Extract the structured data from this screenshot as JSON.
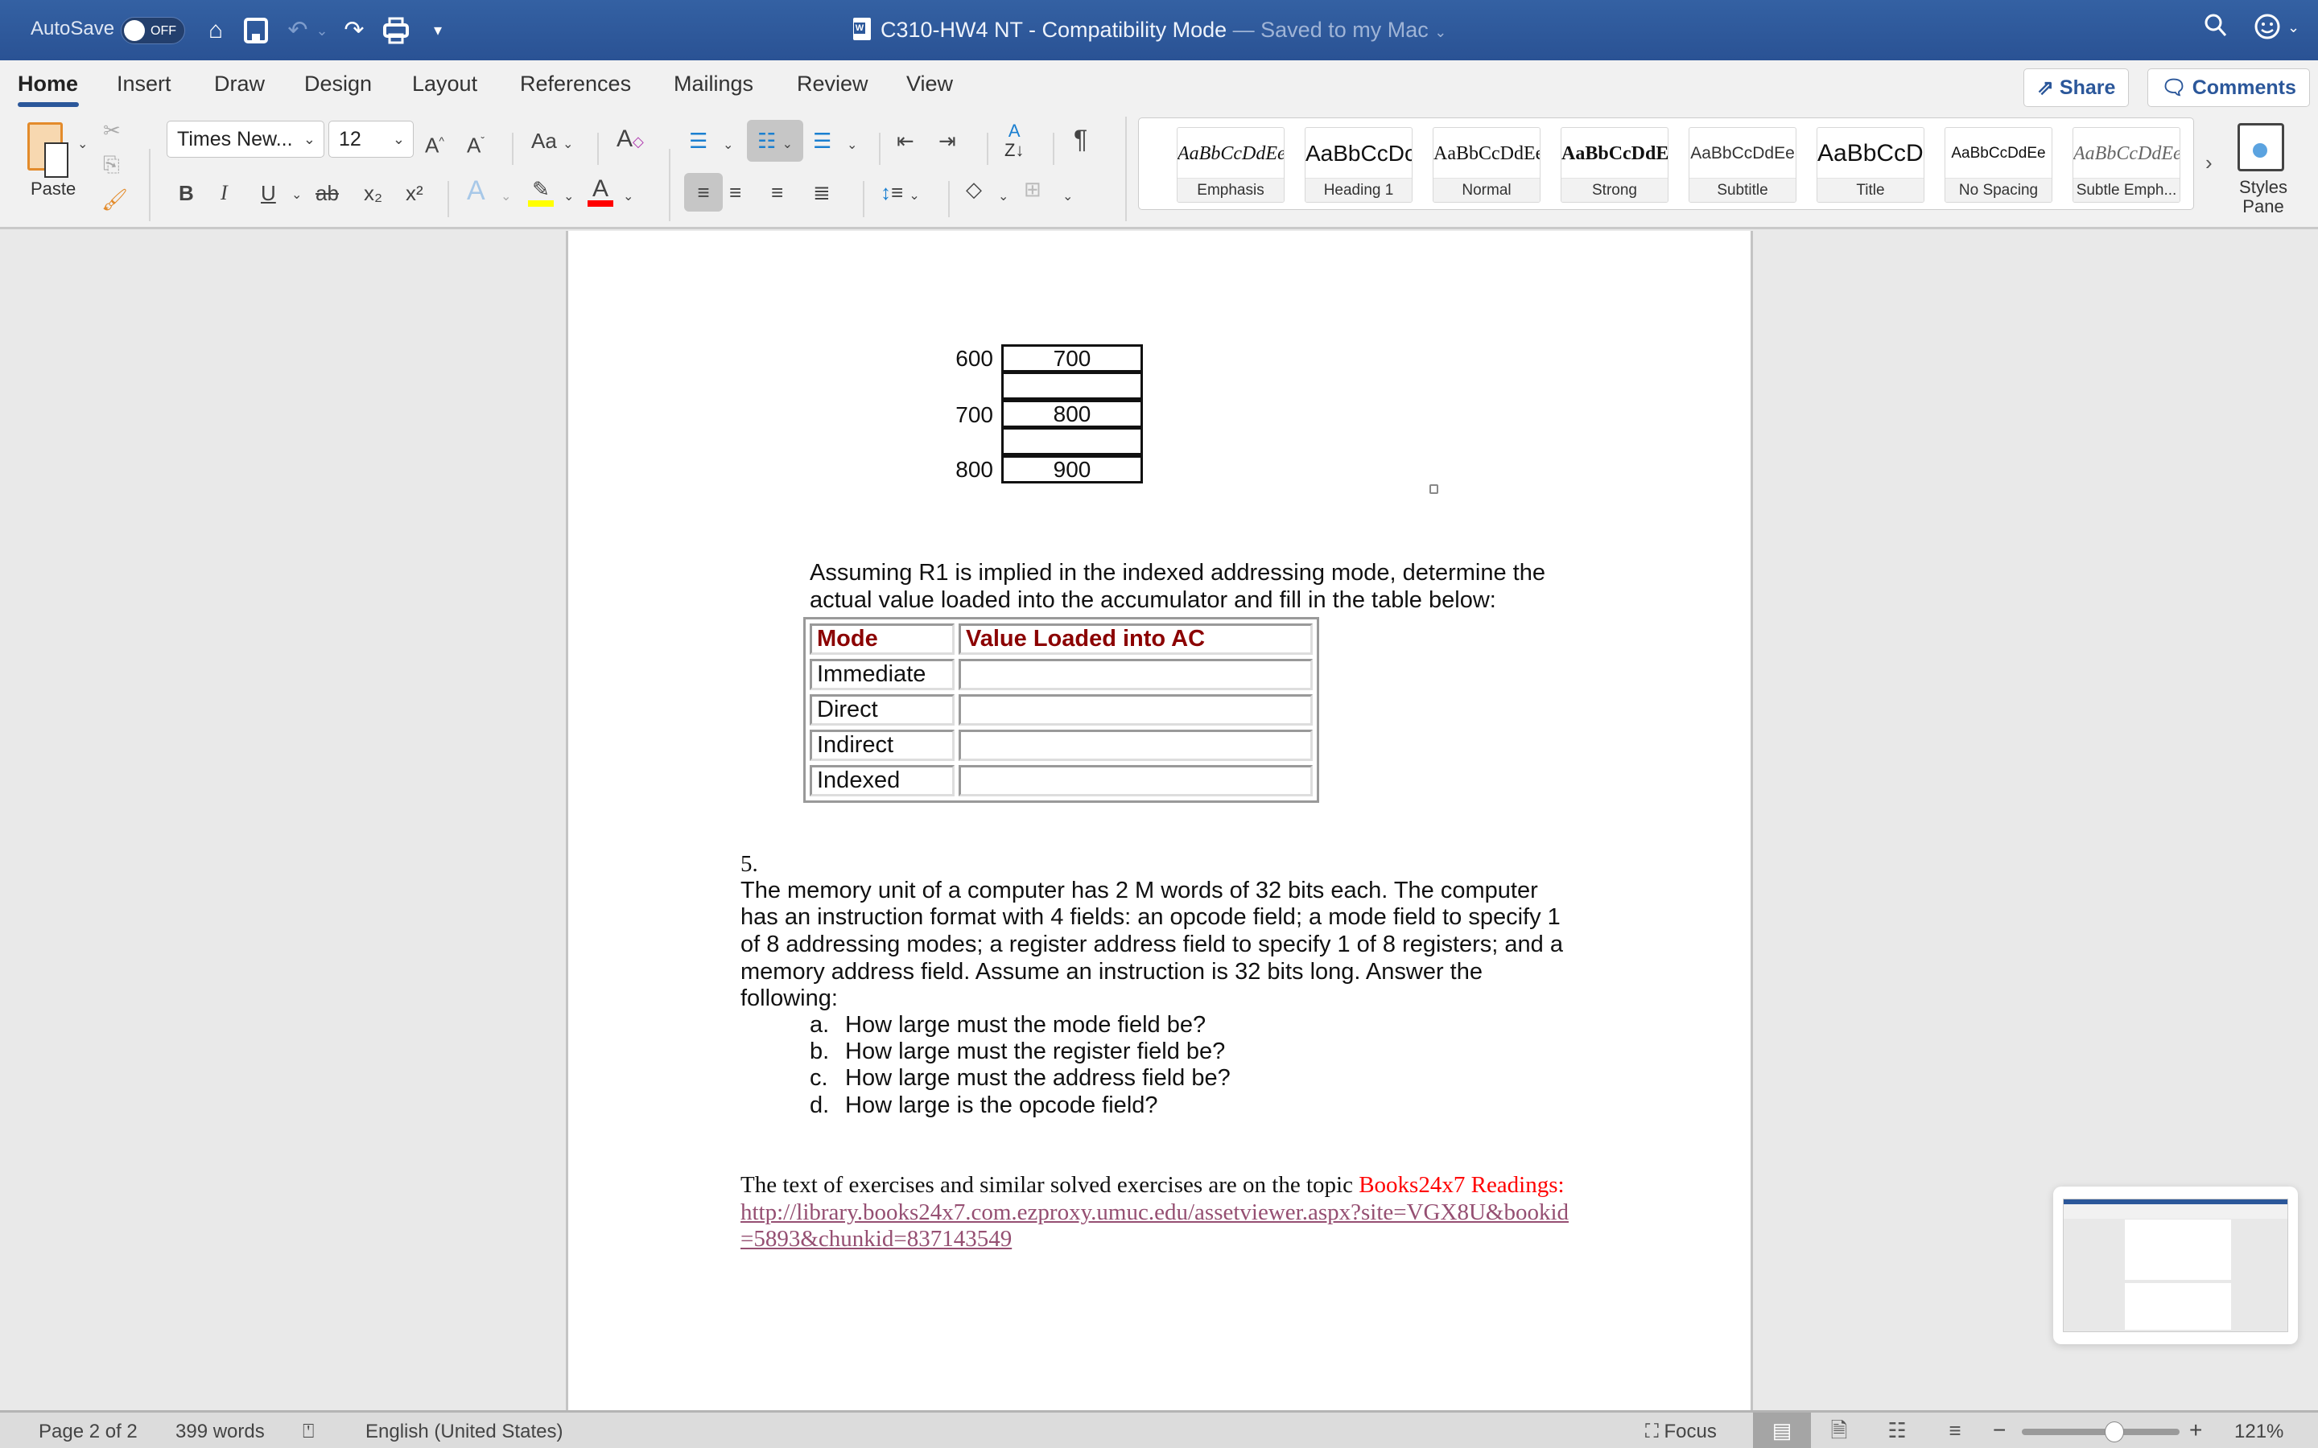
{
  "titlebar": {
    "autosave_label": "AutoSave",
    "autosave_state": "OFF",
    "doc_title": "C310-HW4 NT  -  Compatibility Mode",
    "saved_status": "— Saved to my Mac",
    "icons": [
      "home-icon",
      "save-icon",
      "undo-icon",
      "redo-icon",
      "print-icon",
      "customize-qat-icon",
      "search-icon",
      "feedback-smiley-icon"
    ]
  },
  "tabs": [
    {
      "label": "Home",
      "active": true
    },
    {
      "label": "Insert"
    },
    {
      "label": "Draw"
    },
    {
      "label": "Design"
    },
    {
      "label": "Layout"
    },
    {
      "label": "References"
    },
    {
      "label": "Mailings"
    },
    {
      "label": "Review"
    },
    {
      "label": "View"
    }
  ],
  "top_buttons": {
    "share": "Share",
    "comments": "Comments"
  },
  "ribbon": {
    "paste_label": "Paste",
    "font_name": "Times New...",
    "font_size": "12",
    "change_case": "Aa",
    "bold": "B",
    "italic": "I",
    "underline": "U",
    "strikethrough": "ab",
    "subscript": "x₂",
    "superscript": "x²",
    "highlight_color": "#ffff00",
    "font_color": "#ff0000",
    "styles": [
      {
        "sample": "AaBbCcDdEe",
        "name": "Emphasis"
      },
      {
        "sample": "AaBbCcDc",
        "name": "Heading 1"
      },
      {
        "sample": "AaBbCcDdEe",
        "name": "Normal"
      },
      {
        "sample": "AaBbCcDdE",
        "name": "Strong"
      },
      {
        "sample": "AaBbCcDdEe",
        "name": "Subtitle"
      },
      {
        "sample": "AaBbCcDc",
        "name": "Title"
      },
      {
        "sample": "AaBbCcDdEe",
        "name": "No Spacing"
      },
      {
        "sample": "AaBbCcDdEe",
        "name": "Subtle Emph..."
      }
    ],
    "styles_pane_label": "Styles Pane"
  },
  "document": {
    "memory_rows": [
      {
        "address": "600",
        "content": "700"
      },
      {
        "address": "",
        "content": ""
      },
      {
        "address": "700",
        "content": "800"
      },
      {
        "address": "",
        "content": ""
      },
      {
        "address": "800",
        "content": "900"
      }
    ],
    "instructions_line1": "Assuming R1 is implied in the indexed addressing mode, determine the",
    "instructions_line2": "actual value loaded into the accumulator and fill in the table below:",
    "ac_table": {
      "headers": [
        "Mode",
        "Value Loaded into AC"
      ],
      "rows": [
        [
          "Immediate",
          ""
        ],
        [
          "Direct",
          ""
        ],
        [
          "Indirect",
          ""
        ],
        [
          "Indexed",
          ""
        ]
      ]
    },
    "q5_number": "5.",
    "q5_lines": [
      "The memory unit of a computer has 2 M words of 32 bits each. The computer",
      "has an instruction format with 4 fields: an opcode field; a mode field to specify 1",
      "of 8 addressing modes; a register address field to specify 1 of 8 registers; and a",
      "memory address field. Assume an instruction is 32 bits long. Answer the",
      "following:"
    ],
    "q5_items": [
      {
        "letter": "a.",
        "text": "How large must the mode field be?"
      },
      {
        "letter": "b.",
        "text": "How large must the register field be?"
      },
      {
        "letter": "c.",
        "text": "How large must the address field be?"
      },
      {
        "letter": "d.",
        "text": "How large is the opcode field?"
      }
    ],
    "reference_text": "The text of exercises and similar solved exercises are on the topic ",
    "reference_highlight": "Books24x7 Readings:",
    "reference_link_line1": "http://library.books24x7.com.ezproxy.umuc.edu/assetviewer.aspx?site=VGX8U&bookid",
    "reference_link_line2": "=5893&chunkid=837143549"
  },
  "statusbar": {
    "page": "Page 2 of 2",
    "words": "399 words",
    "language": "English (United States)",
    "focus": "Focus",
    "zoom_percent": "121%",
    "zoom_value": 121
  }
}
